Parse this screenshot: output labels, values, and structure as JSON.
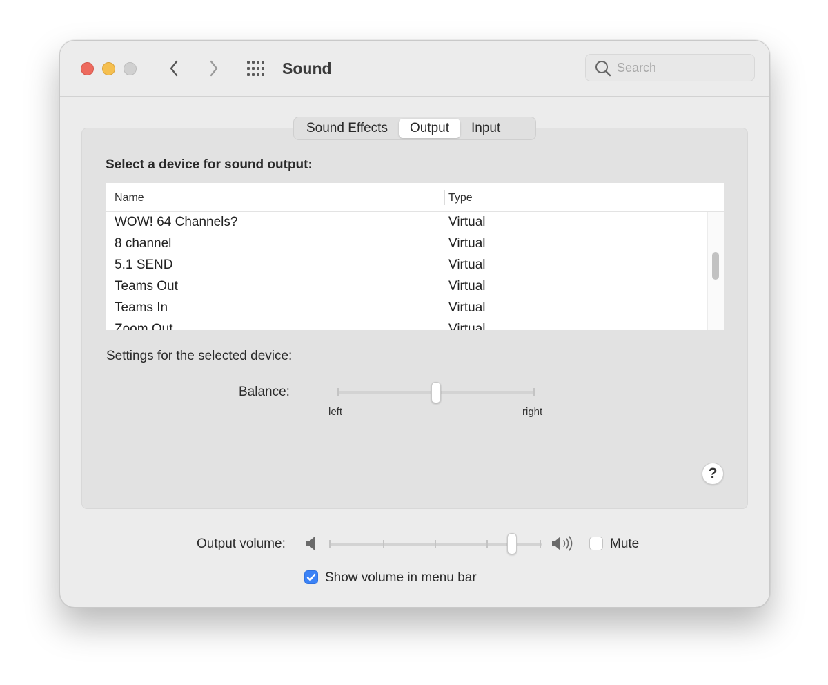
{
  "window": {
    "title": "Sound",
    "accent_color": "#3b82f6",
    "traffic_lights": {
      "close_color": "#ed6a5e",
      "minimize_color": "#f5bf4f",
      "zoom_color": "#d0d0d0"
    }
  },
  "toolbar": {
    "back_icon": "chevron-left-icon",
    "forward_icon": "chevron-right-icon",
    "grid_icon": "show-all-grid-icon",
    "search": {
      "placeholder": "Search",
      "value": "",
      "icon": "search-icon"
    }
  },
  "tabs": [
    {
      "label": "Sound Effects",
      "active": false
    },
    {
      "label": "Output",
      "active": true
    },
    {
      "label": "Input",
      "active": false
    }
  ],
  "output": {
    "heading": "Select a device for sound output:",
    "table": {
      "columns": [
        "Name",
        "Type"
      ],
      "rows": [
        {
          "name": "WOW! 64 Channels?",
          "type": "Virtual"
        },
        {
          "name": "8 channel",
          "type": "Virtual"
        },
        {
          "name": "5.1 SEND",
          "type": "Virtual"
        },
        {
          "name": "Teams Out",
          "type": "Virtual"
        },
        {
          "name": "Teams In",
          "type": "Virtual"
        },
        {
          "name": "Zoom Out",
          "type": "Virtual"
        }
      ]
    },
    "settings_label": "Settings for the selected device:",
    "balance": {
      "label": "Balance:",
      "left_label": "left",
      "right_label": "right",
      "value": 0.5
    },
    "help_label": "?"
  },
  "volume": {
    "label": "Output volume:",
    "value": 0.86,
    "low_icon": "speaker-low-icon",
    "high_icon": "speaker-high-icon",
    "mute": {
      "label": "Mute",
      "checked": false
    },
    "show_in_menu_bar": {
      "label": "Show volume in menu bar",
      "checked": true
    }
  }
}
